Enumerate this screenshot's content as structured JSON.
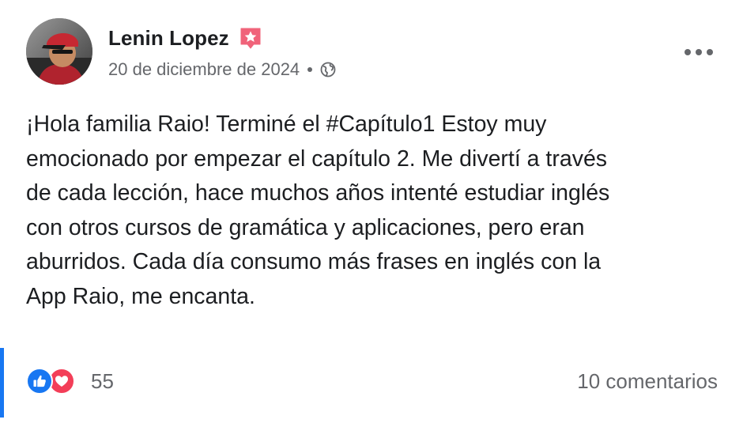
{
  "post": {
    "author": {
      "name": "Lenin Lopez",
      "badge_icon": "star-badge-icon"
    },
    "meta": {
      "date": "20 de diciembre de 2024",
      "privacy_icon": "globe-icon"
    },
    "more_icon": "more-options-icon",
    "text": "¡Hola familia Raio! Terminé el #Capítulo1 Estoy muy\nemocionado por empezar el capítulo 2. Me divertí a través\nde cada lección, hace muchos años intenté estudiar inglés\ncon otros cursos de gramática y aplicaciones, pero eran\naburridos. Cada día consumo más frases en inglés con la\nApp Raio, me encanta.",
    "reactions": {
      "icons": [
        "like-icon",
        "love-icon"
      ],
      "count": "55"
    },
    "comments": "10 comentarios"
  },
  "colors": {
    "accent": "#1877f2",
    "love": "#f33e58",
    "badge": "#f0637a",
    "secondary_text": "#65676b",
    "primary_text": "#1c1e21"
  }
}
